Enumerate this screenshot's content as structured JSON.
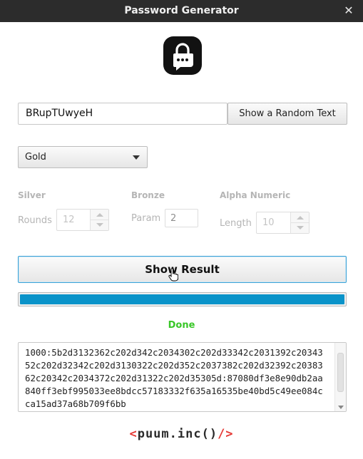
{
  "window": {
    "title": "Password Generator",
    "close_icon": "close-icon"
  },
  "logo": {
    "icon": "lock-chat-icon"
  },
  "input": {
    "value": "BRupTUwyeH"
  },
  "buttons": {
    "random": "Show a Random Text",
    "result": "Show Result"
  },
  "mode_select": {
    "selected": "Gold"
  },
  "sections": {
    "silver": {
      "title": "Silver",
      "label": "Rounds",
      "value": "12"
    },
    "bronze": {
      "title": "Bronze",
      "label": "Param",
      "value": "2"
    },
    "alpha": {
      "title": "Alpha Numeric",
      "label": "Length",
      "value": "10"
    }
  },
  "progress": {
    "value_percent": 100
  },
  "status": {
    "text": "Done"
  },
  "result_text": "1000:5b2d3132362c202d342c2034302c202d33342c2031392c2034352c202d32342c202d3130322c202d352c2037382c202d32392c2038362c20342c2034372c202d31322c202d35305d:87080df3e8e90db2aa840ff3ebf995033ee8bdcc57183332f635a16535be40bd5c49ee084cca15ad37a68b709f6bb",
  "footer": {
    "prefix": "<",
    "brand": "puum.inc()",
    "suffix": "/>"
  },
  "colors": {
    "accent": "#0a93c9",
    "done": "#39c728",
    "brand_red": "#e53935",
    "titlebar": "#2c2c2c"
  }
}
